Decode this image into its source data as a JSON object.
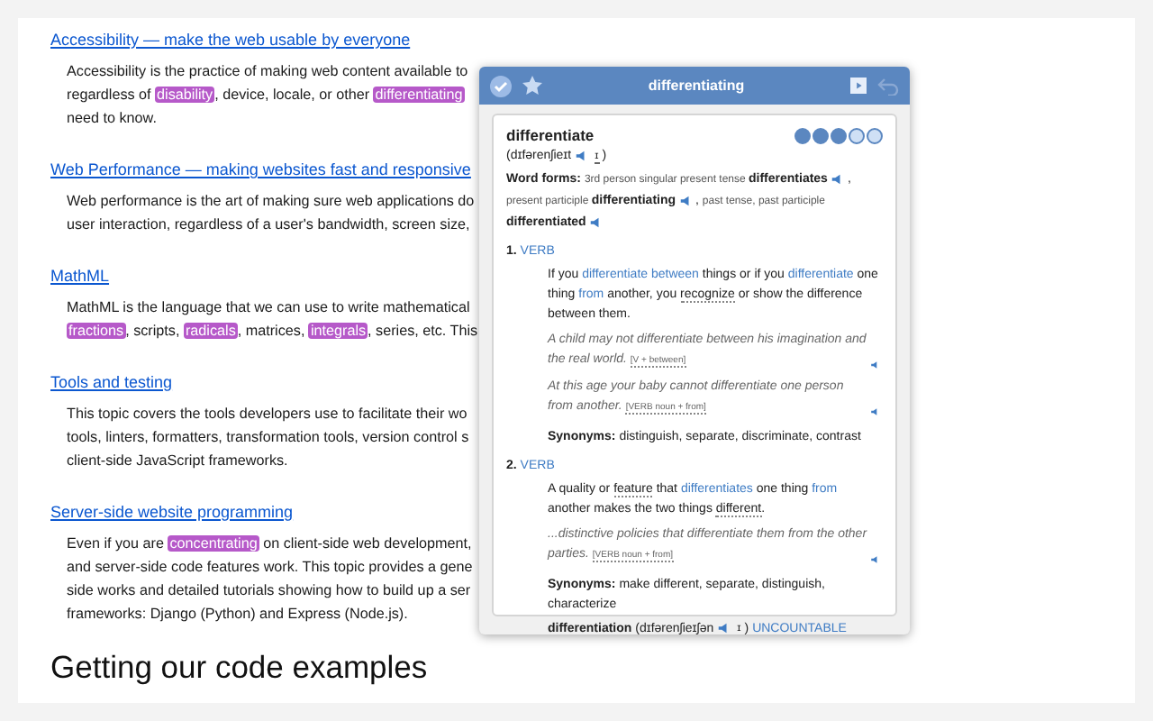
{
  "topics": [
    {
      "link": "Accessibility — make the web usable by everyone",
      "lines": [
        [
          {
            "text": "Accessibility is the practice of making web content available to"
          }
        ],
        [
          {
            "text": "regardless of "
          },
          {
            "text": "disability",
            "highlighted": true
          },
          {
            "text": ", device, locale, or other "
          },
          {
            "text": "differentiating",
            "highlighted": true
          }
        ],
        [
          {
            "text": "need to know."
          }
        ]
      ]
    },
    {
      "link": "Web Performance — making websites fast and responsive",
      "lines": [
        [
          {
            "text": "Web performance is the art of making sure web applications do"
          }
        ],
        [
          {
            "text": "user interaction, regardless of a user's bandwidth, screen size,"
          }
        ]
      ]
    },
    {
      "link": "MathML",
      "lines": [
        [
          {
            "text": "MathML is the language that we can use to write mathematical"
          }
        ],
        [
          {
            "text": "fractions",
            "highlighted": true
          },
          {
            "text": ", scripts, "
          },
          {
            "text": "radicals",
            "highlighted": true
          },
          {
            "text": ", matrices, "
          },
          {
            "text": "integrals",
            "highlighted": true
          },
          {
            "text": ", series, etc. This"
          }
        ]
      ]
    },
    {
      "link": "Tools and testing",
      "lines": [
        [
          {
            "text": "This topic covers the tools developers use to facilitate their wo"
          }
        ],
        [
          {
            "text": "tools, linters, formatters, transformation tools, version control s"
          }
        ],
        [
          {
            "text": "client-side JavaScript frameworks."
          }
        ]
      ]
    },
    {
      "link": "Server-side website programming",
      "lines": [
        [
          {
            "text": "Even if you are "
          },
          {
            "text": "concentrating",
            "highlighted": true
          },
          {
            "text": " on client-side web development,"
          }
        ],
        [
          {
            "text": "and server-side code features work. This topic provides a gene"
          }
        ],
        [
          {
            "text": "side works and detailed tutorials showing how to build up a ser"
          }
        ],
        [
          {
            "text": "frameworks: Django (Python) and Express (Node.js)."
          }
        ]
      ]
    }
  ],
  "heading": "Getting our code examples",
  "popup": {
    "title": "differentiating",
    "headword": "differentiate",
    "stars": 3,
    "pronunciation": "(dɪfərenʃieɪt",
    "pron_mark": "ɪ",
    "pron_close": ")",
    "word_forms_label": "Word forms:",
    "word_forms": [
      {
        "label": "3rd person singular present tense",
        "form": "differentiates",
        "sep": ","
      },
      {
        "label": "present participle",
        "form": "differentiating",
        "sep": ","
      },
      {
        "label": "past tense, past participle",
        "form": "differentiated"
      }
    ],
    "senses": [
      {
        "number": "1.",
        "pos": "VERB",
        "definition": [
          {
            "text": "If you "
          },
          {
            "text": "differentiate between",
            "kind": "link"
          },
          {
            "text": " things or if you "
          },
          {
            "text": "differentiate",
            "kind": "link"
          },
          {
            "text": " one thing "
          },
          {
            "text": "from",
            "kind": "link"
          },
          {
            "text": " another, you "
          },
          {
            "text": "recognize",
            "kind": "dotted"
          },
          {
            "text": " or show the difference between them."
          }
        ],
        "examples": [
          {
            "text": "A child may not differentiate between his imagination and the real world.",
            "tag": "[V + between]"
          },
          {
            "text": "At this age your baby cannot differentiate one person from another.",
            "tag": "[VERB noun + from]"
          }
        ],
        "synonyms_label": "Synonyms:",
        "synonyms": "distinguish, separate, discriminate, contrast"
      },
      {
        "number": "2.",
        "pos": "VERB",
        "definition": [
          {
            "text": "A quality or "
          },
          {
            "text": "feature",
            "kind": "dotted"
          },
          {
            "text": " that "
          },
          {
            "text": "differentiates",
            "kind": "link"
          },
          {
            "text": " one thing "
          },
          {
            "text": "from",
            "kind": "link"
          },
          {
            "text": " another makes the two things "
          },
          {
            "text": "different",
            "kind": "dotted"
          },
          {
            "text": "."
          }
        ],
        "examples": [
          {
            "text": "...distinctive policies that differentiate them from the other parties.",
            "tag": "[VERB noun + from]"
          }
        ],
        "synonyms_label": "Synonyms:",
        "synonyms": "make different, separate, distinguish, characterize"
      }
    ],
    "derived": {
      "word": "differentiation",
      "pronunciation": "(dɪfərenʃieɪʃən",
      "pron_mark": "ɪ",
      "pron_close": ")",
      "label": "UNCOUNTABLE"
    }
  }
}
